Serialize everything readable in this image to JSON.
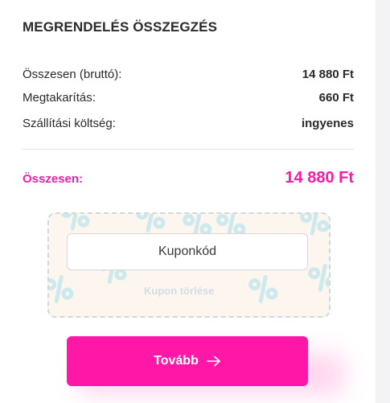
{
  "summary": {
    "title": "MEGRENDELÉS ÖSSZEGZÉS",
    "rows": [
      {
        "label": "Összesen (bruttó):",
        "value": "14 880 Ft"
      },
      {
        "label": "Megtakarítás:",
        "value": "660 Ft"
      },
      {
        "label": "Szállítási költség:",
        "value": "ingyenes"
      }
    ],
    "total_label": "Összesen:",
    "total_value": "14 880 Ft"
  },
  "coupon": {
    "placeholder": "Kuponkód",
    "remove_label": "Kupon törlése"
  },
  "cta": {
    "label": "Tovább",
    "icon": "arrow-right-icon"
  },
  "colors": {
    "accent": "#ff17a8",
    "coupon_pattern": "#cde9ee",
    "coupon_bg": "#fdf6ef"
  }
}
